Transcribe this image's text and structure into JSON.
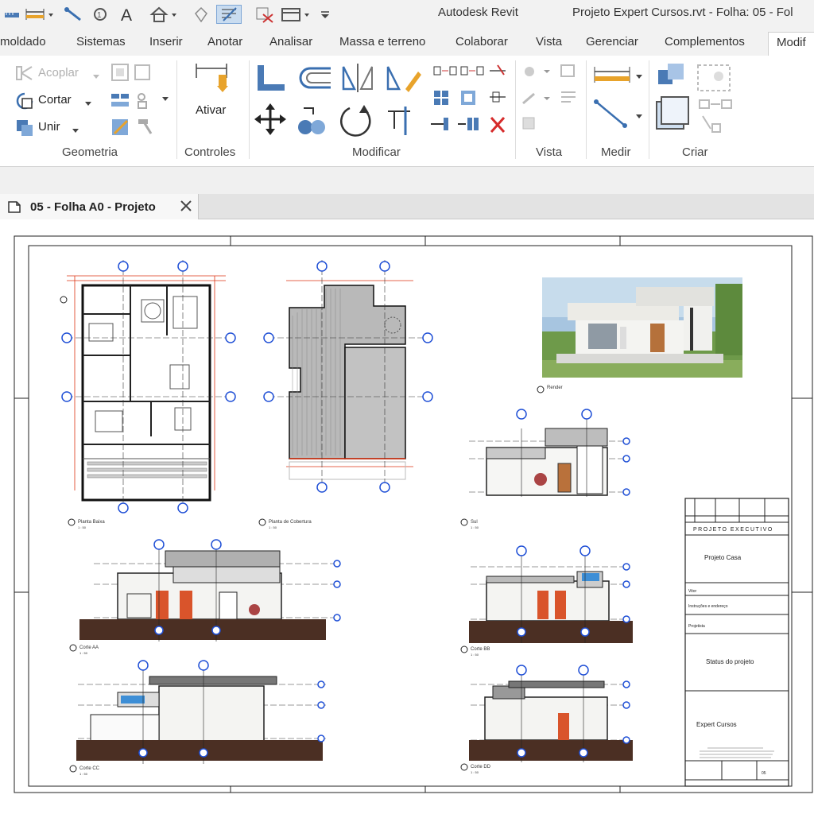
{
  "app": {
    "title": "Autodesk Revit",
    "document_title": "Projeto Expert Cursos.rvt - Folha: 05 - Fol"
  },
  "quick_access": [
    "measure-icon",
    "align-icon",
    "tag-icon",
    "text-icon",
    "home-icon",
    "section-icon",
    "thin-lines-icon",
    "close-hidden-icon",
    "switch-windows-icon"
  ],
  "ribbon_tabs": [
    {
      "label": "moldado"
    },
    {
      "label": "Sistemas"
    },
    {
      "label": "Inserir"
    },
    {
      "label": "Anotar"
    },
    {
      "label": "Analisar"
    },
    {
      "label": "Massa e terreno"
    },
    {
      "label": "Colaborar"
    },
    {
      "label": "Vista"
    },
    {
      "label": "Gerenciar"
    },
    {
      "label": "Complementos"
    },
    {
      "label": "Modif"
    }
  ],
  "ribbon": {
    "geometry": {
      "acoplar": "Acoplar",
      "cortar": "Cortar",
      "unir": "Unir",
      "label": "Geometria"
    },
    "controls": {
      "ativar": "Ativar",
      "label": "Controles"
    },
    "modify_label": "Modificar",
    "view_label": "Vista",
    "measure_label": "Medir",
    "create_label": "Criar"
  },
  "view_tab": {
    "label": "05 - Folha A0 - Projeto"
  },
  "sheet": {
    "views": {
      "planta_baixa": {
        "title": "Planta Baixa",
        "scale": "1 : 50"
      },
      "planta_cobertura": {
        "title": "Planta de Cobertura",
        "scale": "1 : 50"
      },
      "render": {
        "title": "Render"
      },
      "sul": {
        "title": "Sul",
        "scale": "1 : 50"
      },
      "corte_aa": {
        "title": "Corte AA",
        "scale": "1 : 50"
      },
      "corte_bb": {
        "title": "Corte BB",
        "scale": "1 : 50"
      },
      "corte_cc": {
        "title": "Corte CC",
        "scale": "1 : 50"
      },
      "corte_dd": {
        "title": "Corte DD",
        "scale": "1 : 50"
      }
    },
    "title_block": {
      "header": "PROJETO EXECUTIVO",
      "project": "Projeto Casa",
      "client": "Vitor",
      "address": "Instruções e endereço",
      "designers": "Projetista",
      "status": "Status do projeto",
      "company": "Expert Cursos",
      "sheet_number": "05"
    }
  }
}
